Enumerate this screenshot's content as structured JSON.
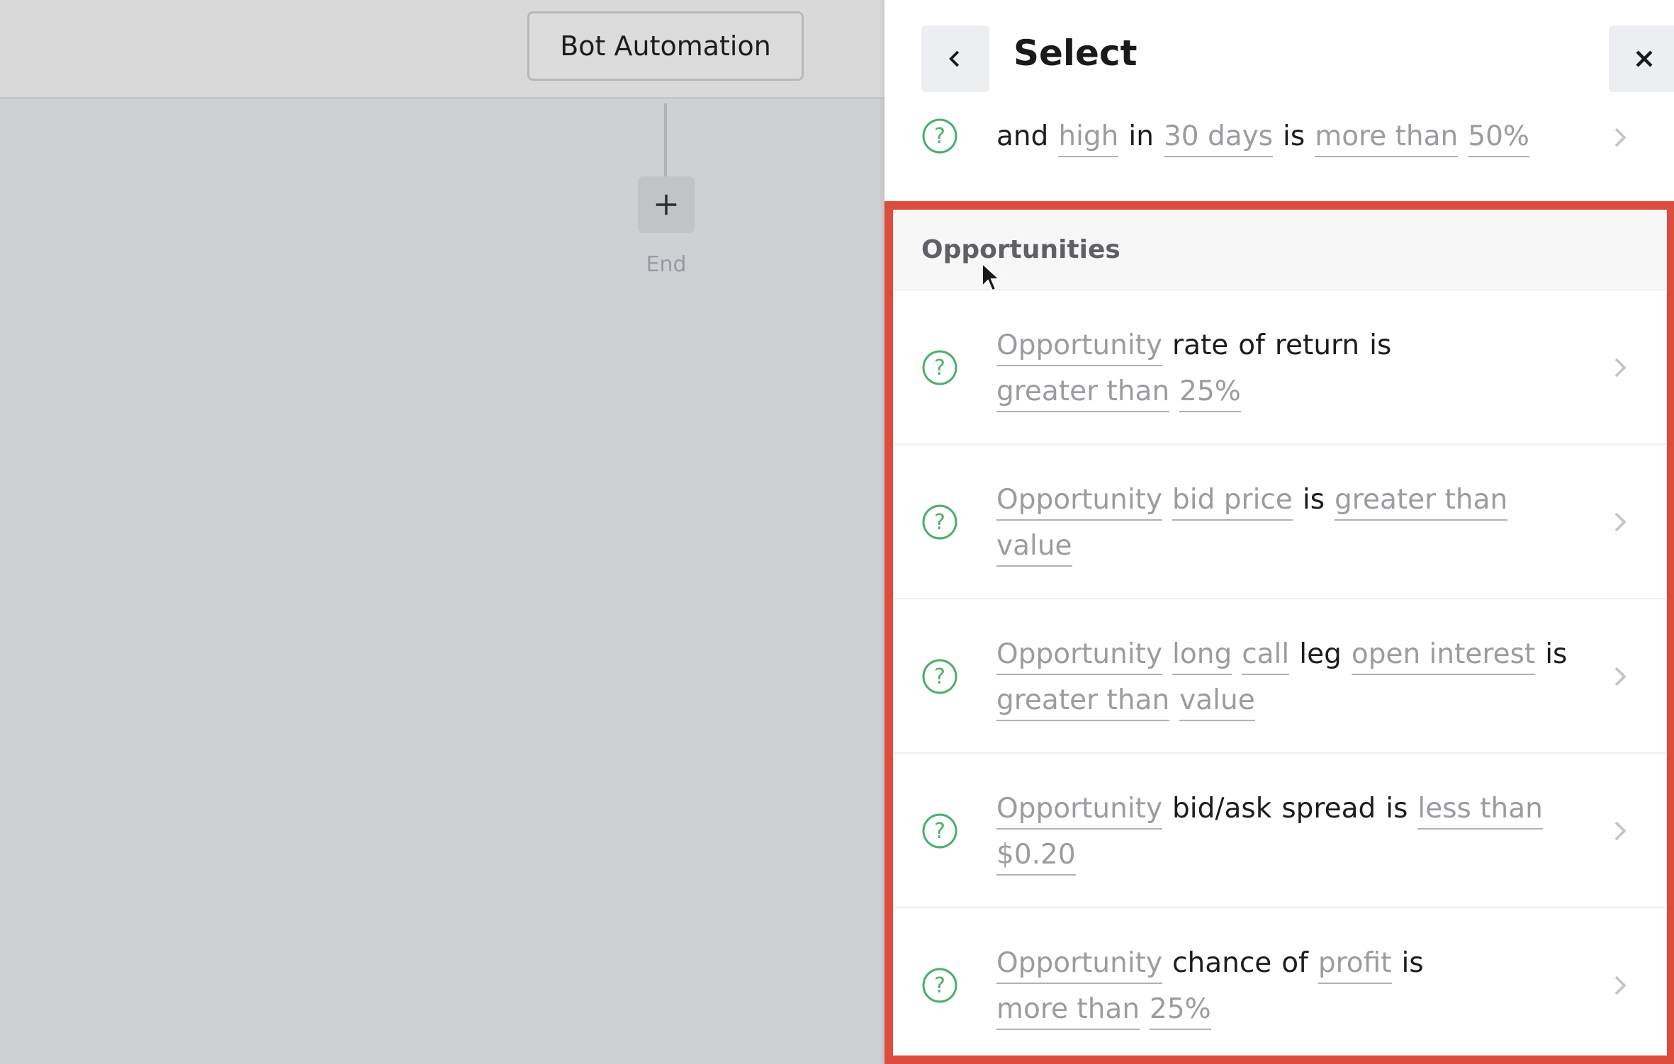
{
  "canvas": {
    "bot_node_label": "Bot Automation",
    "add_node_icon": "plus-icon",
    "end_label": "End"
  },
  "panel": {
    "title": "Select",
    "back_icon": "chevron-left-icon",
    "close_icon": "close-icon",
    "partial_item": {
      "line2_tokens": [
        {
          "text": "and",
          "kind": "static"
        },
        {
          "text": "high",
          "kind": "param"
        },
        {
          "text": "in",
          "kind": "static"
        },
        {
          "text": "30 days",
          "kind": "param"
        },
        {
          "text": "is",
          "kind": "static"
        },
        {
          "text": "more than",
          "kind": "param"
        },
        {
          "text": "50%",
          "kind": "param"
        }
      ]
    },
    "section": {
      "title": "Opportunities",
      "items": [
        {
          "line1": [
            {
              "text": "Opportunity",
              "kind": "param"
            },
            {
              "text": "rate",
              "kind": "static"
            },
            {
              "text": "of",
              "kind": "static"
            },
            {
              "text": "return",
              "kind": "static"
            },
            {
              "text": "is",
              "kind": "static"
            }
          ],
          "line2": [
            {
              "text": "greater than",
              "kind": "param"
            },
            {
              "text": "25%",
              "kind": "param"
            }
          ]
        },
        {
          "line1": [
            {
              "text": "Opportunity",
              "kind": "param"
            },
            {
              "text": "bid price",
              "kind": "param"
            },
            {
              "text": "is",
              "kind": "static"
            },
            {
              "text": "greater than",
              "kind": "param"
            }
          ],
          "line2": [
            {
              "text": "value",
              "kind": "param"
            }
          ]
        },
        {
          "line1": [
            {
              "text": "Opportunity",
              "kind": "param"
            },
            {
              "text": "long",
              "kind": "param"
            },
            {
              "text": "call",
              "kind": "param"
            },
            {
              "text": "leg",
              "kind": "static"
            },
            {
              "text": "open interest",
              "kind": "param"
            },
            {
              "text": "is",
              "kind": "static"
            }
          ],
          "line2": [
            {
              "text": "greater than",
              "kind": "param"
            },
            {
              "text": "value",
              "kind": "param"
            }
          ]
        },
        {
          "line1": [
            {
              "text": "Opportunity",
              "kind": "param"
            },
            {
              "text": "bid/ask",
              "kind": "static"
            },
            {
              "text": "spread",
              "kind": "static"
            },
            {
              "text": "is",
              "kind": "static"
            },
            {
              "text": "less than",
              "kind": "param"
            }
          ],
          "line2": [
            {
              "text": "$0.20",
              "kind": "param"
            }
          ]
        },
        {
          "line1": [
            {
              "text": "Opportunity",
              "kind": "param"
            },
            {
              "text": "chance",
              "kind": "static"
            },
            {
              "text": "of",
              "kind": "static"
            },
            {
              "text": "profit",
              "kind": "param"
            },
            {
              "text": "is",
              "kind": "static"
            }
          ],
          "line2": [
            {
              "text": "more than",
              "kind": "param"
            },
            {
              "text": "25%",
              "kind": "param"
            }
          ]
        }
      ]
    }
  },
  "colors": {
    "accent_green": "#4caf6a",
    "highlight_red": "#dd4c3c",
    "param_text": "#9b9ca1"
  }
}
